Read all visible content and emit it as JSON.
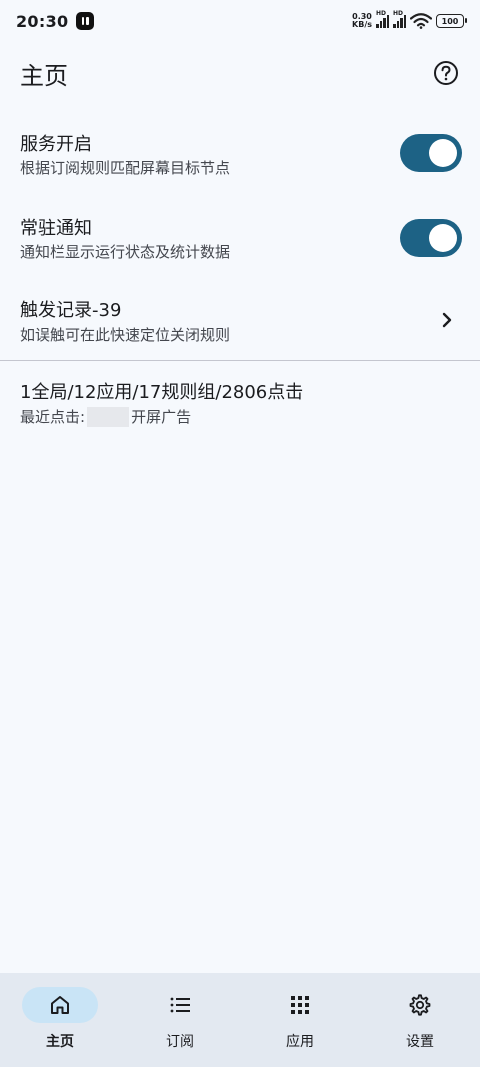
{
  "status_bar": {
    "time": "20:30",
    "net_speed_value": "0.30",
    "net_speed_unit": "KB/s",
    "sim1_label": "HD",
    "sim2_label": "HD",
    "battery": "100"
  },
  "header": {
    "title": "主页"
  },
  "settings": [
    {
      "title": "服务开启",
      "subtitle": "根据订阅规则匹配屏幕目标节点",
      "enabled": true
    },
    {
      "title": "常驻通知",
      "subtitle": "通知栏显示运行状态及统计数据",
      "enabled": true
    }
  ],
  "trigger_log": {
    "title": "触发记录-39",
    "subtitle": "如误触可在此快速定位关闭规则"
  },
  "stats": {
    "summary": "1全局/12应用/17规则组/2806点击",
    "recent_prefix": "最近点击:",
    "recent_suffix": "开屏广告"
  },
  "bottom_nav": [
    {
      "label": "主页",
      "icon": "home-icon",
      "active": true
    },
    {
      "label": "订阅",
      "icon": "list-icon",
      "active": false
    },
    {
      "label": "应用",
      "icon": "apps-grid-icon",
      "active": false
    },
    {
      "label": "设置",
      "icon": "settings-gear-icon",
      "active": false
    }
  ],
  "colors": {
    "background": "#f6f9fd",
    "accent": "#1d6285",
    "nav_background": "#e3e9f1",
    "nav_active": "#c9e4f6"
  }
}
